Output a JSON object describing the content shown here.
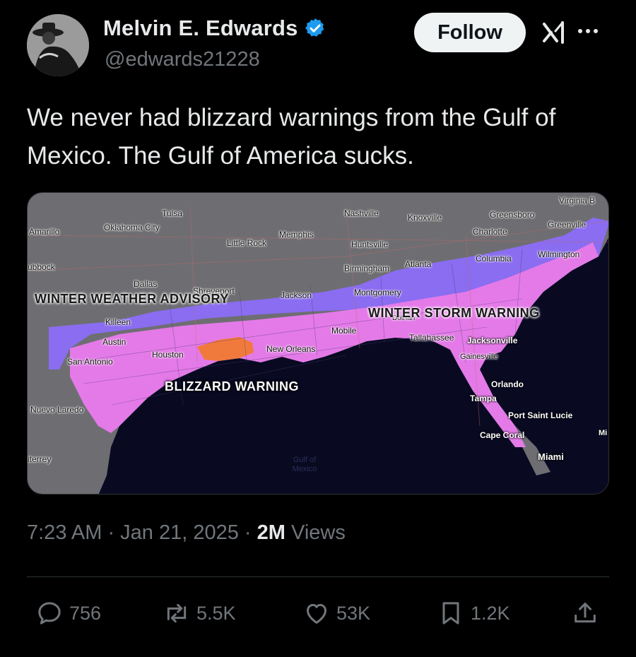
{
  "author": {
    "display_name": "Melvin E. Edwards",
    "handle": "@edwards21228",
    "verified_color": "#1d9bf0"
  },
  "header": {
    "follow_label": "Follow",
    "grok_icon": "grok-icon",
    "more_icon": "more-icon"
  },
  "tweet": {
    "text": "We never had blizzard warnings from the Gulf of Mexico. The Gulf of America sucks."
  },
  "map": {
    "cities": [
      {
        "id": "virginia-beach",
        "label": "Virginia B"
      },
      {
        "id": "tulsa",
        "label": "Tulsa"
      },
      {
        "id": "nashville",
        "label": "Nashville"
      },
      {
        "id": "knoxville",
        "label": "Knoxville"
      },
      {
        "id": "greensboro",
        "label": "Greensboro"
      },
      {
        "id": "greenville",
        "label": "Greenville"
      },
      {
        "id": "amarillo",
        "label": "Amarillo"
      },
      {
        "id": "oklahoma-city",
        "label": "Oklahoma City"
      },
      {
        "id": "memphis",
        "label": "Memphis"
      },
      {
        "id": "charlotte",
        "label": "Charlotte"
      },
      {
        "id": "little-rock",
        "label": "Little Rock"
      },
      {
        "id": "huntsville",
        "label": "Huntsville"
      },
      {
        "id": "wilmington",
        "label": "Wilmington"
      },
      {
        "id": "columbia",
        "label": "Columbia"
      },
      {
        "id": "lubbock",
        "label": "ubbock"
      },
      {
        "id": "birmingham",
        "label": "Birmingham"
      },
      {
        "id": "atlanta",
        "label": "Atlanta"
      },
      {
        "id": "dallas",
        "label": "Dallas"
      },
      {
        "id": "shreveport",
        "label": "Shreveport"
      },
      {
        "id": "jackson",
        "label": "Jackson"
      },
      {
        "id": "montgomery",
        "label": "Montgomery"
      },
      {
        "id": "dothan",
        "label": "Dothan"
      },
      {
        "id": "killeen",
        "label": "Killeen"
      },
      {
        "id": "mobile",
        "label": "Mobile"
      },
      {
        "id": "tallahassee",
        "label": "Tallahassee"
      },
      {
        "id": "jacksonville",
        "label": "Jacksonville"
      },
      {
        "id": "austin",
        "label": "Austin"
      },
      {
        "id": "houston",
        "label": "Houston"
      },
      {
        "id": "new-orleans",
        "label": "New Orleans"
      },
      {
        "id": "gainesville",
        "label": "Gainesville"
      },
      {
        "id": "san-antonio",
        "label": "San Antonio"
      },
      {
        "id": "orlando",
        "label": "Orlando"
      },
      {
        "id": "tampa",
        "label": "Tampa"
      },
      {
        "id": "nuevo-laredo",
        "label": "Nuevo Laredo"
      },
      {
        "id": "port-saint-lucie",
        "label": "Port Saint Lucie"
      },
      {
        "id": "cape-coral",
        "label": "Cape Coral"
      },
      {
        "id": "miami-edge",
        "label": "Mi"
      },
      {
        "id": "monterrey",
        "label": "iterrey"
      },
      {
        "id": "miami",
        "label": "Miami"
      }
    ],
    "zones": {
      "advisory": "WINTER WEATHER ADVISORY",
      "storm": "WINTER STORM WARNING",
      "blizzard": "BLIZZARD WARNING"
    },
    "gulf_label": "Gulf of Mexico",
    "colors": {
      "water": "#090a22",
      "land": "#6e6e72",
      "advisory": "#8a6df0",
      "storm": "#e47ae8",
      "blizzard": "#f07a3c"
    }
  },
  "meta": {
    "time_date": "7:23 AM · Jan 21, 2025 · ",
    "views_count": "2M",
    "views_label": " Views"
  },
  "actions": {
    "replies": "756",
    "reposts": "5.5K",
    "likes": "53K",
    "bookmarks": "1.2K",
    "reply_icon": "reply-icon",
    "repost_icon": "repost-icon",
    "like_icon": "like-icon",
    "bookmark_icon": "bookmark-icon",
    "share_icon": "share-icon"
  }
}
